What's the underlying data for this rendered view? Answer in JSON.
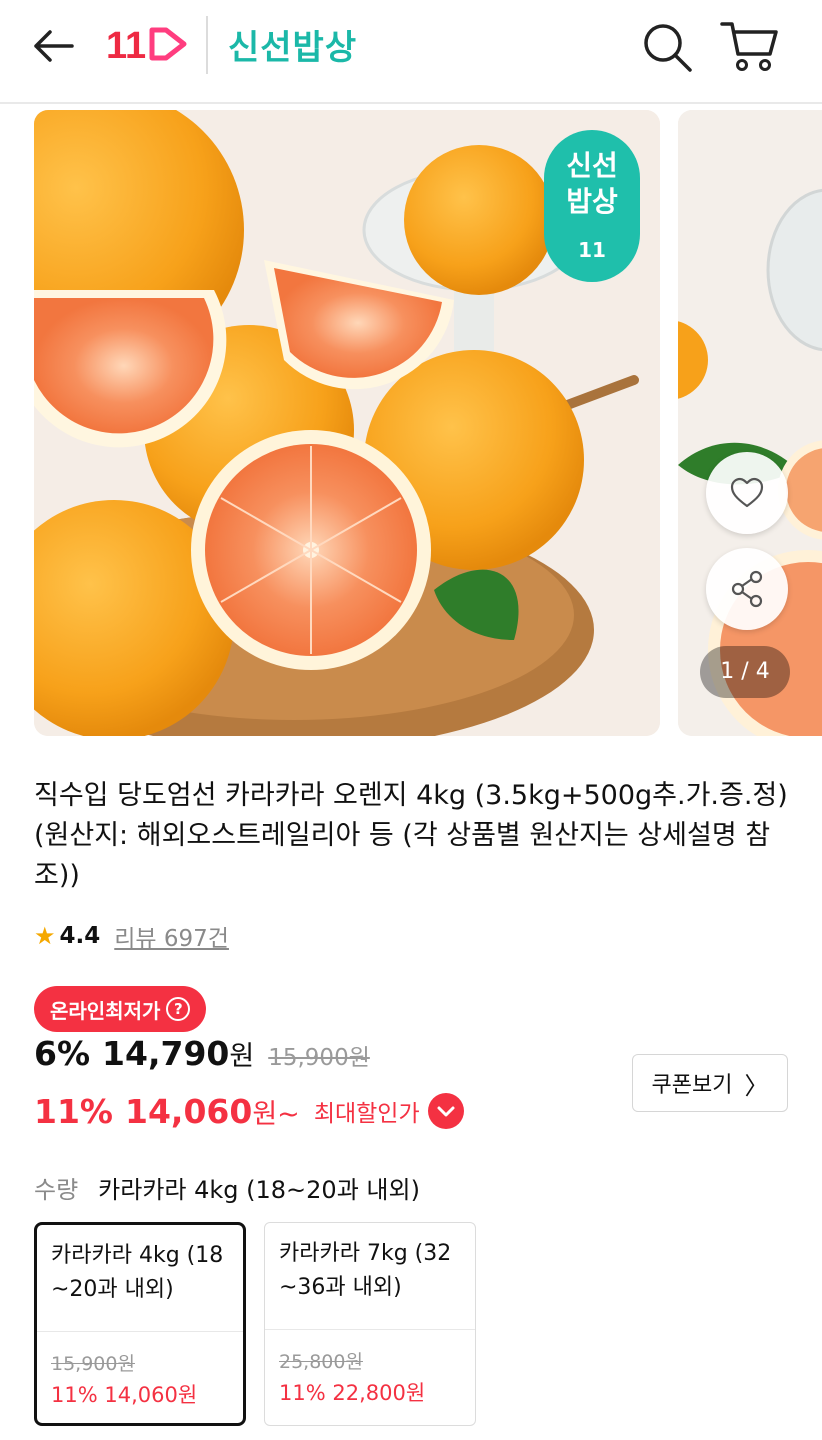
{
  "header": {
    "logo_text": "11",
    "brand_title": "신선밥상"
  },
  "carousel": {
    "badge_line1": "신선",
    "badge_line2": "밥상",
    "badge_logo": "11",
    "page_counter": "1 / 4"
  },
  "product": {
    "title": "직수입 당도엄선 카라카라 오렌지 4kg (3.5kg+500g추.가.증.정) (원산지: 해외오스트레일리아 등 (각 상품별 원산지는 상세설명 참조))",
    "rating": "4.4",
    "review_label": "리뷰 697건"
  },
  "price": {
    "lowest_badge": "온라인최저가",
    "help_glyph": "?",
    "discount": "6%",
    "sale_price": "14,790",
    "won": "원",
    "original_price": "15,900원",
    "max_discount": "11%",
    "max_price": "14,060",
    "max_won": "원~",
    "max_label": "최대할인가",
    "coupon_label": "쿠폰보기",
    "coupon_chevron": "〉"
  },
  "quantity": {
    "label": "수량",
    "selected": "카라카라 4kg (18~20과 내외)"
  },
  "options": [
    {
      "name": "카라카라 4kg (18~20과 내외)",
      "original": "15,900원",
      "price": "11% 14,060원",
      "selected": true
    },
    {
      "name": "카라카라 7kg (32~36과 내외)",
      "original": "25,800원",
      "price": "11% 22,800원",
      "selected": false
    }
  ],
  "colors": {
    "accent_red": "#f43142",
    "brand_teal": "#1bb8a8",
    "logo_red": "#ee2a43",
    "logo_pink": "#ff3d7f"
  },
  "icons": {
    "back": "back-arrow-icon",
    "search": "search-icon",
    "cart": "cart-icon",
    "heart": "heart-icon",
    "share": "share-icon",
    "star": "star-icon",
    "chevron": "chevron-down-icon"
  }
}
